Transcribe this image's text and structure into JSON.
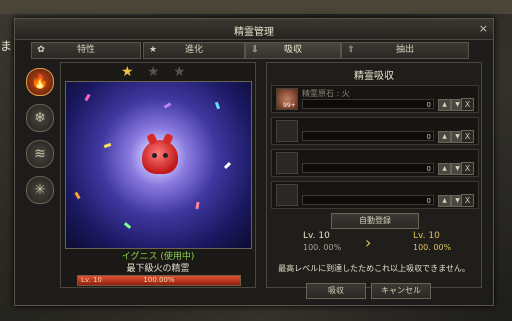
{
  "background": {
    "text": "ました"
  },
  "window": {
    "title": "精霊管理",
    "close_glyph": "×"
  },
  "tabs": [
    {
      "label": "特性",
      "active": false
    },
    {
      "label": "進化",
      "active": false
    },
    {
      "label": "吸収",
      "active": true
    },
    {
      "label": "抽出",
      "active": false
    }
  ],
  "sidebar": [
    {
      "icon": "fire-element-icon",
      "glyph": "🔥",
      "active": true
    },
    {
      "icon": "ice-element-icon",
      "glyph": "❄",
      "active": false
    },
    {
      "icon": "wind-element-icon",
      "glyph": "≋",
      "active": false
    },
    {
      "icon": "light-element-icon",
      "glyph": "✳",
      "active": false
    }
  ],
  "spirit": {
    "stars_filled": 1,
    "stars_total": 3,
    "name": "イグニス (使用中)",
    "description": "最下級火の精霊",
    "level_label": "Lv. 10",
    "exp_text": "100.00%",
    "exp_fraction": 1.0
  },
  "absorb": {
    "title": "精霊吸収",
    "slots": [
      {
        "filled": true,
        "count": "99+",
        "name": "精霊原石 : 火",
        "value": "0"
      },
      {
        "filled": false,
        "count": "",
        "name": "",
        "value": "0"
      },
      {
        "filled": false,
        "count": "",
        "name": "",
        "value": "0"
      },
      {
        "filled": false,
        "count": "",
        "name": "",
        "value": "0"
      }
    ],
    "up_glyph": "▲",
    "down_glyph": "▼",
    "delete_glyph": "X",
    "auto_register_label": "自動登録",
    "arrow_glyph": "›",
    "current": {
      "level": "Lv. 10",
      "percent": "100. 00%"
    },
    "result": {
      "level": "Lv. 10",
      "percent": "100. 00%"
    },
    "message": "最高レベルに到達したためこれ以上吸収できません。"
  },
  "buttons": {
    "absorb": "吸収",
    "cancel": "キャンセル"
  },
  "colors": {
    "accent_gold": "#e0c060",
    "green_name": "#8ad04a",
    "exp_red": "#e05030"
  }
}
